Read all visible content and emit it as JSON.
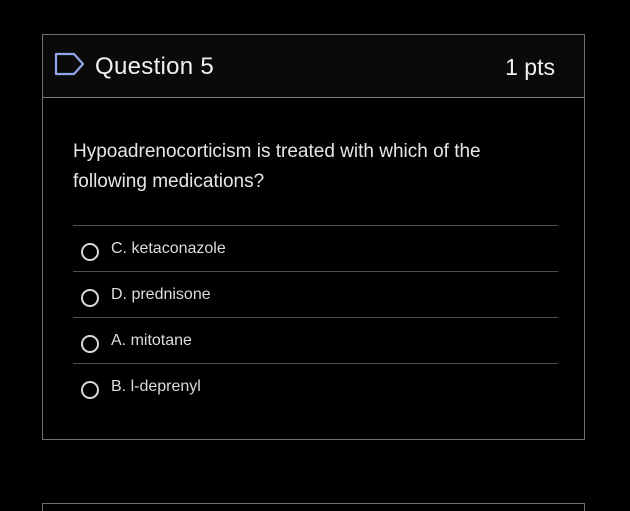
{
  "question": {
    "title": "Question 5",
    "points": "1 pts",
    "text": "Hypoadrenocorticism is treated with which of the following medications?",
    "flag_icon": "flag-outline-icon"
  },
  "answers": [
    {
      "label": "C. ketaconazole",
      "selected": false
    },
    {
      "label": "D. prednisone",
      "selected": false
    },
    {
      "label": "A. mitotane",
      "selected": false
    },
    {
      "label": "B. l-deprenyl",
      "selected": false
    }
  ],
  "colors": {
    "background": "#000000",
    "border": "#6f6f6f",
    "text": "#e8e8e8"
  }
}
